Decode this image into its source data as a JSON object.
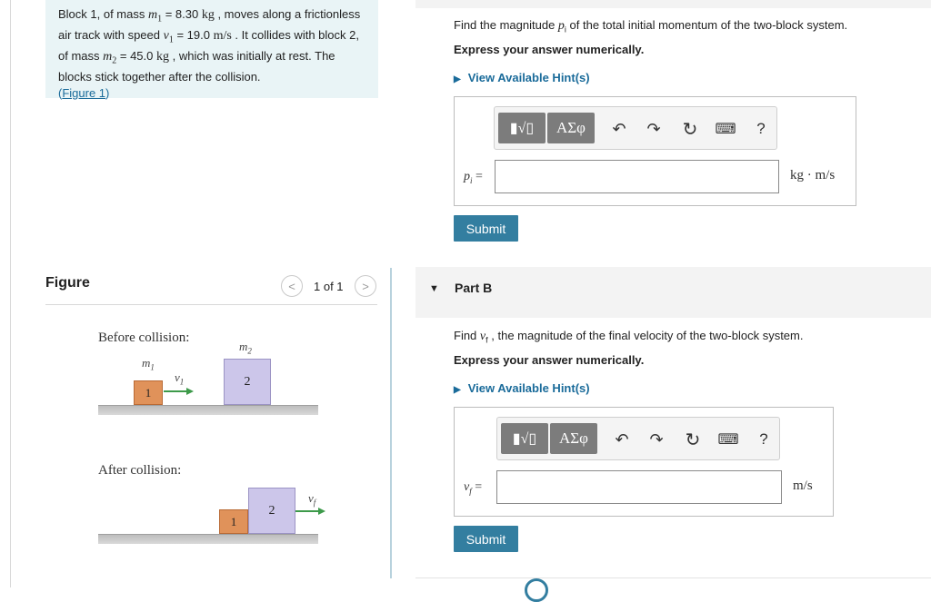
{
  "problem": {
    "t1": "Block 1, of mass ",
    "m1": "m",
    "m1_sub": "1",
    "m1_val": " = 8.30 ",
    "m1_unit": "kg",
    "t2": " , moves along a frictionless air track with speed ",
    "v1": "v",
    "v1_sub": "1",
    "v1_val": " = 19.0 ",
    "v1_unit": "m/s",
    "t3": " . It collides with block 2, of mass ",
    "m2": "m",
    "m2_sub": "2",
    "m2_val": " = 45.0 ",
    "m2_unit": "kg",
    "t4": " , which was initially at rest. The blocks stick together after the collision.",
    "link_open": "(",
    "link_text": "Figure 1",
    "link_close": ")"
  },
  "figure": {
    "title": "Figure",
    "pager": "1 of 1",
    "prev_icon": "chevron-left-icon",
    "next_icon": "chevron-right-icon",
    "before_label": "Before collision:",
    "after_label": "After collision:",
    "m1_label": "m",
    "m1_sub": "1",
    "m2_label": "m",
    "m2_sub": "2",
    "v1_label": "v",
    "v1_sub": "1",
    "vf_label": "v",
    "vf_sub": "f",
    "block1": "1",
    "block2": "2"
  },
  "partA": {
    "q_pre": "Find the magnitude ",
    "q_var": "p",
    "q_sub": "i",
    "q_post": " of the total initial momentum of the two-block system.",
    "instruction": "Express your answer numerically.",
    "hint": "View Available Hint(s)",
    "var_label": "p",
    "var_sub": "i",
    "equals": " =",
    "input_value": "",
    "unit": "kg · m/s",
    "submit": "Submit"
  },
  "partB": {
    "title": "Part B",
    "q_pre": "Find ",
    "q_var": "v",
    "q_sub": "f",
    "q_post": " , the magnitude of the final velocity of the two-block system.",
    "instruction": "Express your answer numerically.",
    "hint": "View Available Hint(s)",
    "var_label": "v",
    "var_sub": "f",
    "equals": " =",
    "input_value": "",
    "unit": "m/s",
    "submit": "Submit"
  },
  "toolbar": {
    "template_icon": "template-radical-icon",
    "greek": "ΑΣφ",
    "help": "?",
    "undo_icon": "undo-icon",
    "redo_icon": "redo-icon",
    "reset_icon": "reset-icon",
    "keyboard_icon": "keyboard-icon",
    "help_icon": "help-icon"
  },
  "colors": {
    "accent": "#337ea0",
    "link": "#1a6b9a",
    "problem_bg": "#e9f4f6",
    "block1": "#e0925a",
    "block2": "#ccc6ea",
    "arrow": "#3d9a4a"
  }
}
